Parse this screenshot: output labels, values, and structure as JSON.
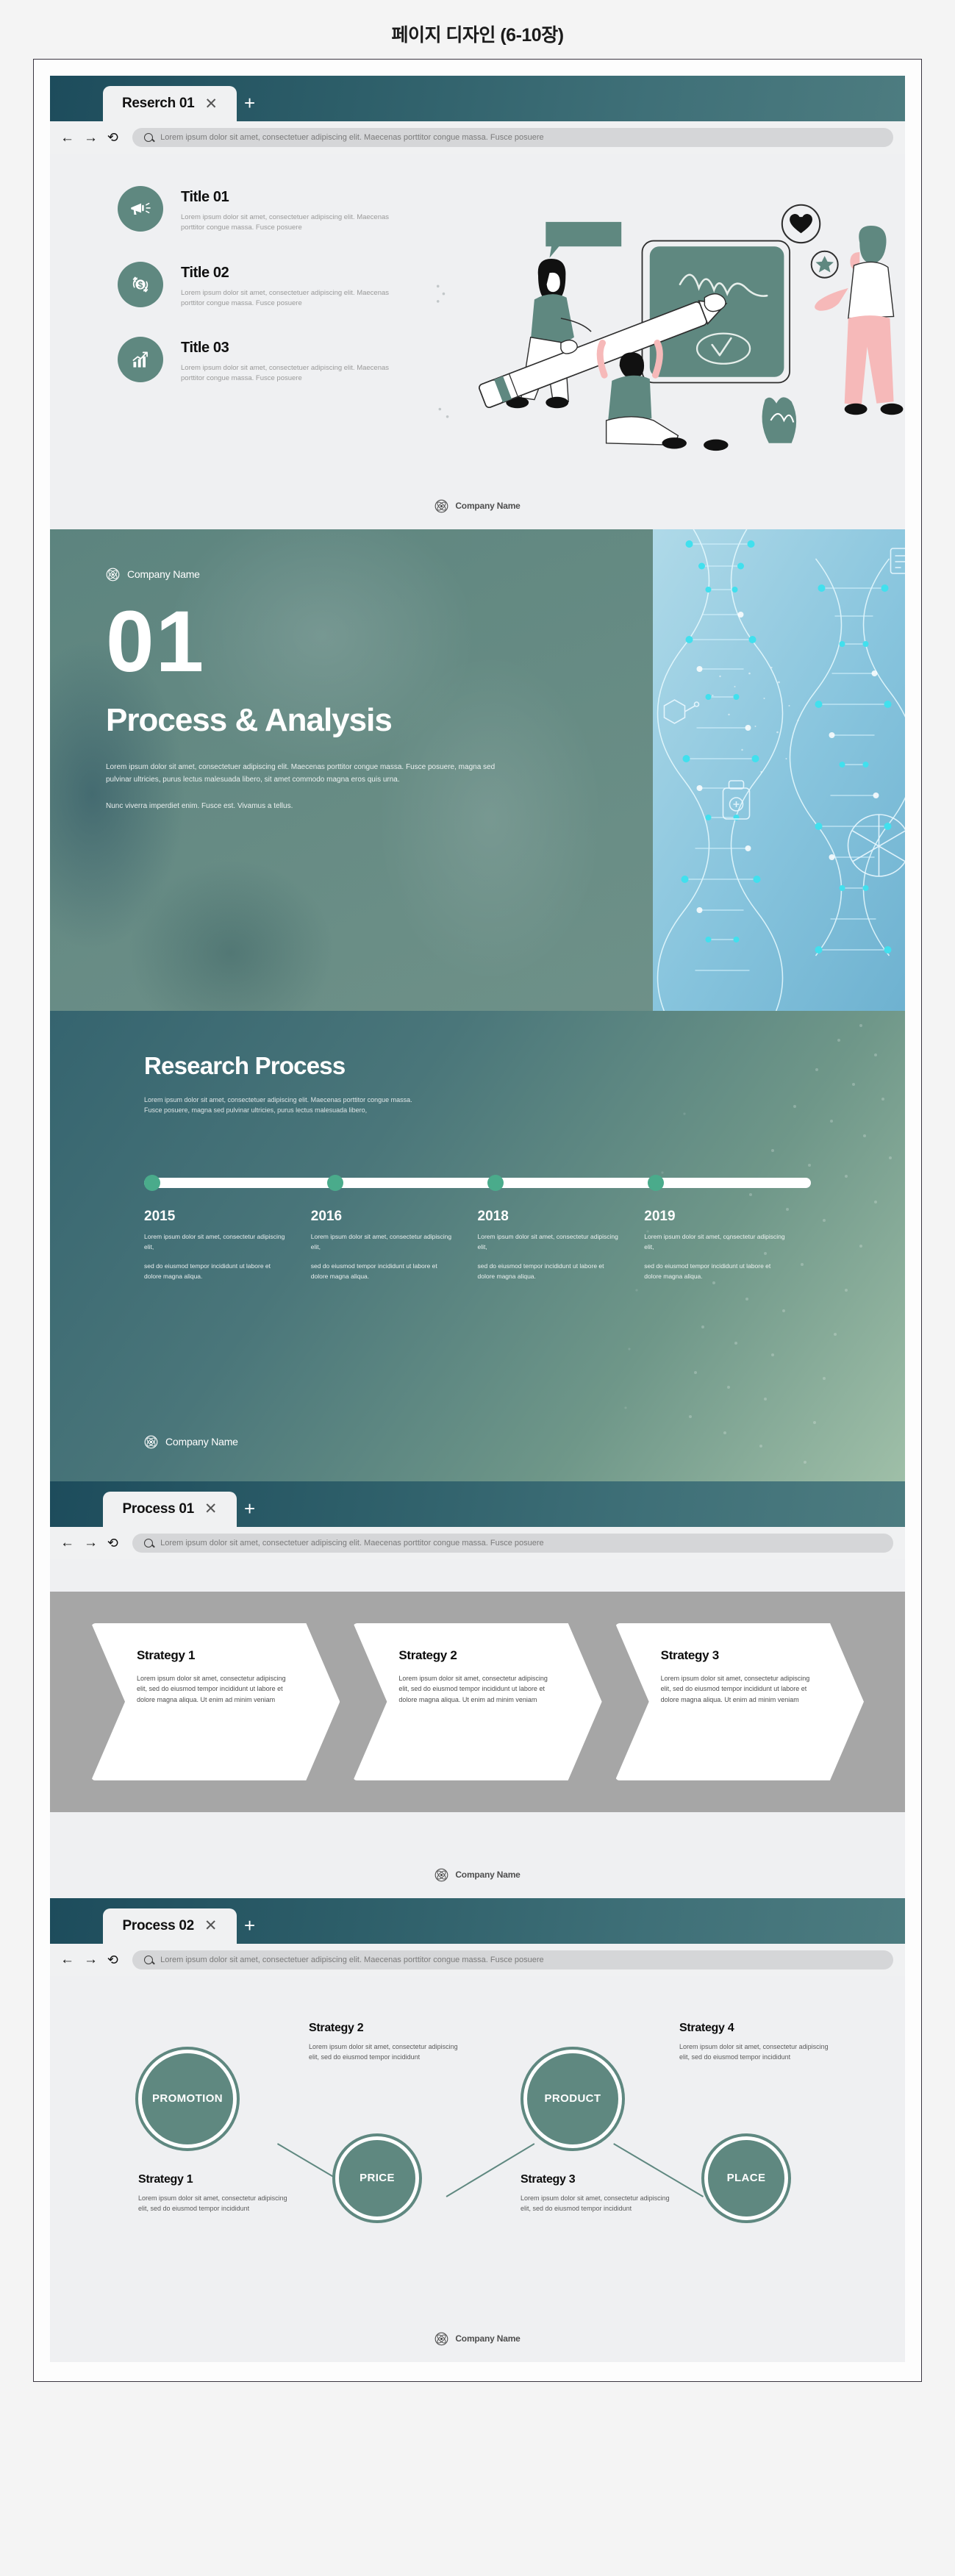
{
  "page": {
    "title": "페이지 디자인 (6-10장)"
  },
  "brand": {
    "name": "Company Name",
    "logo_icon": "atom-logo-icon",
    "accent": "#5f8880",
    "teal_dark": "#1d4c5c",
    "dot_green": "#4aab8b",
    "band_gray": "#a6a6a6"
  },
  "browser": {
    "nav": {
      "back_icon": "arrow-left-icon",
      "forward_icon": "arrow-right-icon",
      "reload_icon": "reload-icon",
      "search_icon": "search-icon"
    },
    "new_tab_label": "+",
    "close_label": "✕",
    "url_text": "Lorem ipsum dolor sit amet, consectetuer adipiscing elit. Maecenas porttitor congue massa. Fusce posuere",
    "tabs": [
      {
        "label": "Reserch 01"
      },
      {
        "label": "Process 01"
      },
      {
        "label": "Process 02"
      }
    ]
  },
  "slide_titles": {
    "items": [
      {
        "icon": "megaphone-icon",
        "title": "Title 01",
        "body": "Lorem ipsum dolor sit amet, consectetuer adipiscing elit. Maecenas porttitor congue massa. Fusce posuere"
      },
      {
        "icon": "money-exchange-icon",
        "title": "Title 02",
        "body": "Lorem ipsum dolor sit amet, consectetuer adipiscing elit. Maecenas porttitor congue massa. Fusce posuere"
      },
      {
        "icon": "growth-chart-icon",
        "title": "Title 03",
        "body": "Lorem ipsum dolor sit amet, consectetuer adipiscing elit. Maecenas porttitor congue massa. Fusce posuere"
      }
    ],
    "illustration": "people-with-giant-pencil-illustration"
  },
  "hero": {
    "number": "01",
    "heading": "Process & Analysis",
    "paragraph1": "Lorem ipsum dolor sit amet, consectetuer adipiscing elit. Maecenas porttitor congue massa. Fusce posuere, magna sed pulvinar ultricies, purus lectus malesuada libero, sit amet commodo magna eros quis urna.",
    "paragraph2": "Nunc viverra imperdiet enim. Fusce est. Vivamus a tellus.",
    "image": "dna-helix-biotech-image"
  },
  "process": {
    "heading": "Research Process",
    "paragraph": "Lorem ipsum dolor sit amet, consectetuer adipiscing elit. Maecenas porttitor congue massa. Fusce posuere, magna sed pulvinar ultricies, purus lectus malesuada libero,",
    "timeline": [
      {
        "year": "2015",
        "line1": "Lorem ipsum dolor sit amet, consectetur adipiscing elit,",
        "line2": "sed do eiusmod tempor incididunt ut labore et dolore magna aliqua."
      },
      {
        "year": "2016",
        "line1": "Lorem ipsum dolor sit amet, consectetur adipiscing elit,",
        "line2": "sed do eiusmod tempor incididunt ut labore et dolore magna aliqua."
      },
      {
        "year": "2018",
        "line1": "Lorem ipsum dolor sit amet, consectetur adipiscing elit,",
        "line2": "sed do eiusmod tempor incididunt ut labore et dolore magna aliqua."
      },
      {
        "year": "2019",
        "line1": "Lorem ipsum dolor sit amet, consectetur adipiscing elit,",
        "line2": "sed do eiusmod tempor incididunt ut labore et dolore magna aliqua."
      }
    ]
  },
  "arrows": {
    "cards": [
      {
        "title": "Strategy 1",
        "body": "Lorem ipsum dolor sit amet, consectetur adipiscing elit, sed do eiusmod tempor incididunt ut labore et dolore magna aliqua. Ut enim ad minim veniam"
      },
      {
        "title": "Strategy 2",
        "body": "Lorem ipsum dolor sit amet, consectetur adipiscing elit, sed do eiusmod tempor incididunt ut labore et dolore magna aliqua. Ut enim ad minim veniam"
      },
      {
        "title": "Strategy 3",
        "body": "Lorem ipsum dolor sit amet, consectetur adipiscing elit, sed do eiusmod tempor incididunt ut labore et dolore magna aliqua. Ut enim ad minim veniam"
      }
    ]
  },
  "circles": {
    "nodes": [
      {
        "label": "PROMOTION"
      },
      {
        "label": "PRICE"
      },
      {
        "label": "PRODUCT"
      },
      {
        "label": "PLACE"
      }
    ],
    "captions": [
      {
        "title": "Strategy 1",
        "body": "Lorem ipsum dolor sit amet, consectetur adipiscing elit, sed do eiusmod tempor incididunt"
      },
      {
        "title": "Strategy 2",
        "body": "Lorem ipsum dolor sit amet, consectetur adipiscing elit, sed do eiusmod tempor incididunt"
      },
      {
        "title": "Strategy 3",
        "body": "Lorem ipsum dolor sit amet, consectetur adipiscing elit, sed do eiusmod tempor incididunt"
      },
      {
        "title": "Strategy 4",
        "body": "Lorem ipsum dolor sit amet, consectetur adipiscing elit, sed do eiusmod tempor incididunt"
      }
    ]
  }
}
